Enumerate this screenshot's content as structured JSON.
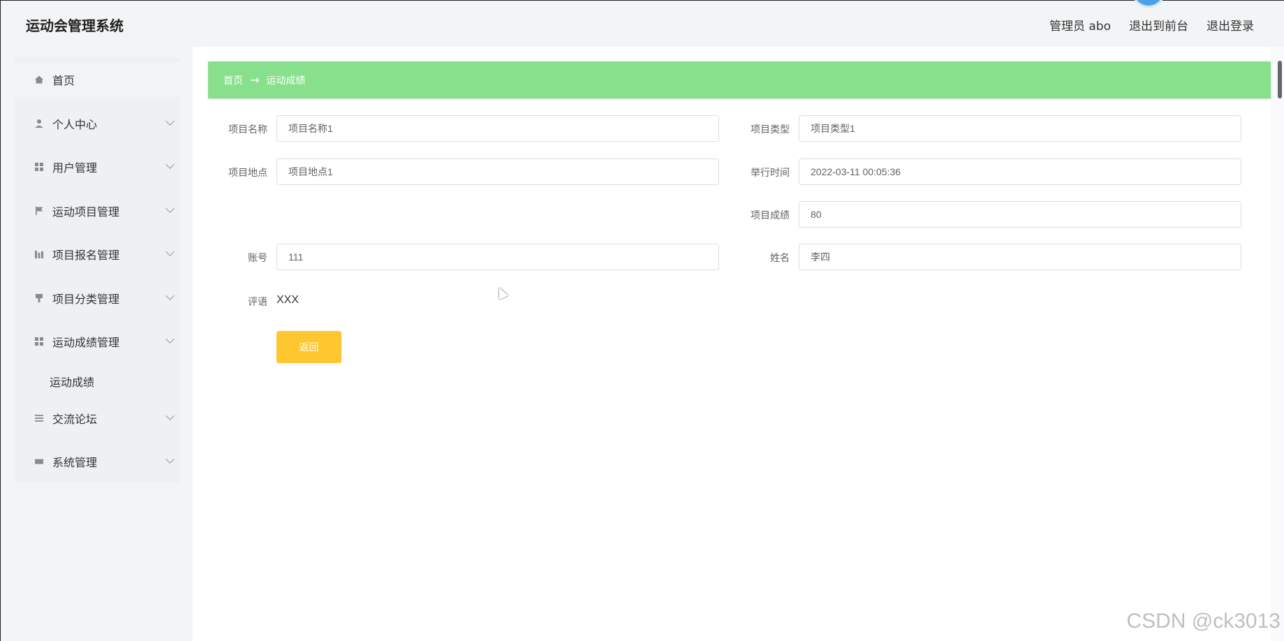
{
  "header": {
    "title": "运动会管理系统",
    "user": "管理员 abo",
    "to_front": "退出到前台",
    "logout": "退出登录"
  },
  "sidebar": {
    "items": [
      {
        "label": "首页",
        "icon": "home-icon"
      },
      {
        "label": "个人中心",
        "icon": "user-icon"
      },
      {
        "label": "用户管理",
        "icon": "grid-icon"
      },
      {
        "label": "运动项目管理",
        "icon": "flag-icon"
      },
      {
        "label": "项目报名管理",
        "icon": "chart-icon"
      },
      {
        "label": "项目分类管理",
        "icon": "brush-icon"
      },
      {
        "label": "运动成绩管理",
        "icon": "grid-icon"
      },
      {
        "label": "交流论坛",
        "icon": "list-icon"
      },
      {
        "label": "系统管理",
        "icon": "ticket-icon"
      }
    ],
    "sub_items": [
      {
        "label": "运动成绩"
      }
    ]
  },
  "breadcrumb": {
    "home": "首页",
    "arrow": "→",
    "current": "运动成绩"
  },
  "form": {
    "project_name": {
      "label": "项目名称",
      "value": "项目名称1"
    },
    "project_type": {
      "label": "项目类型",
      "value": "项目类型1"
    },
    "project_place": {
      "label": "项目地点",
      "value": "项目地点1"
    },
    "hold_time": {
      "label": "举行时间",
      "value": "2022-03-11 00:05:36"
    },
    "score": {
      "label": "项目成绩",
      "value": "80"
    },
    "account": {
      "label": "账号",
      "value": "111"
    },
    "name": {
      "label": "姓名",
      "value": "李四"
    },
    "remark": {
      "label": "评语",
      "value": "XXX"
    },
    "back_label": "返回"
  },
  "watermark": "CSDN @ck3013",
  "colors": {
    "breadcrumb_bg": "#88e08d",
    "button_bg": "#fec62f"
  }
}
